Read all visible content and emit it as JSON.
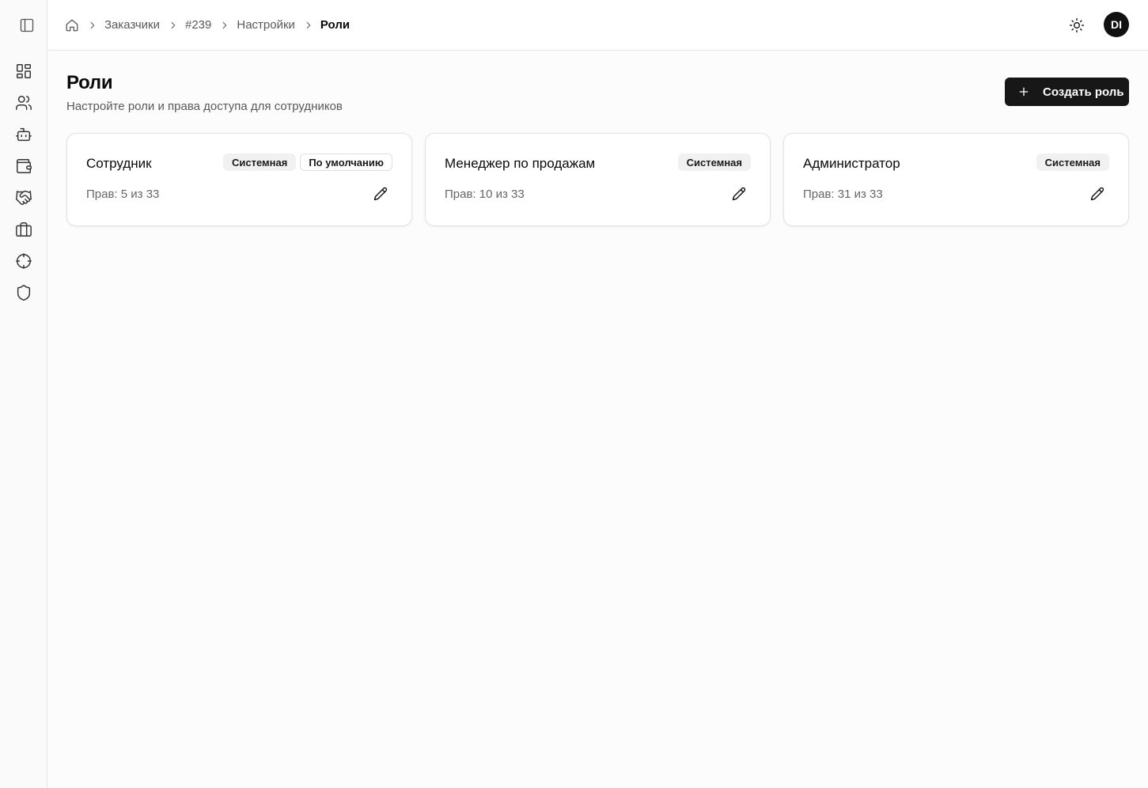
{
  "breadcrumb": {
    "items": [
      "Заказчики",
      "#239",
      "Настройки"
    ],
    "current": "Роли"
  },
  "user": {
    "initials": "DI"
  },
  "page": {
    "title": "Роли",
    "subtitle": "Настройте роли и права доступа для сотрудников",
    "create_button": "Создать роль"
  },
  "roles": [
    {
      "name": "Сотрудник",
      "badges": [
        "Системная",
        "По умолчанию"
      ],
      "perms": "Прав: 5 из 33"
    },
    {
      "name": "Менеджер по продажам",
      "badges": [
        "Системная"
      ],
      "perms": "Прав: 10 из 33"
    },
    {
      "name": "Администратор",
      "badges": [
        "Системная"
      ],
      "perms": "Прав: 31 из 33"
    }
  ],
  "sidebar": {
    "icons": [
      "dashboard-icon",
      "users-icon",
      "bot-icon",
      "wallet-icon",
      "handshake-icon",
      "briefcase-icon",
      "target-icon",
      "shield-icon"
    ]
  },
  "colors": {
    "primary": "#171717",
    "muted_text": "#595959",
    "border": "#e5e5e5"
  }
}
